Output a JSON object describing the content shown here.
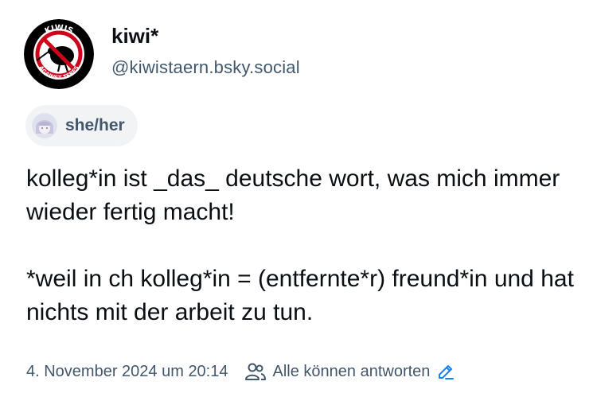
{
  "author": {
    "display_name": "kiwi*",
    "handle": "@kiwistaern.bsky.social",
    "avatar_badge": {
      "top_text": "KIWIS",
      "bottom_text": "AGAINST TERFS",
      "icon": "kiwi-bird-icon"
    }
  },
  "pronouns": {
    "label": "she/her",
    "icon": "pronoun-avatar"
  },
  "post": {
    "paragraphs": [
      "kolleg*in ist _das_ deutsche wort, was mich immer wieder fertig macht!",
      "*weil in ch kolleg*in = (entfernte*r) freund*in und hat nichts mit der arbeit zu tun."
    ]
  },
  "meta": {
    "timestamp": "4. November 2024 um 20:14",
    "reply_setting": "Alle können antworten",
    "reply_icon": "people-icon",
    "edit_icon": "pencil-icon"
  },
  "colors": {
    "text_primary": "#0b0f14",
    "text_secondary": "#42576c",
    "chip_bg": "#f1f3f5",
    "accent": "#1083fe",
    "badge_red": "#d0021b"
  }
}
